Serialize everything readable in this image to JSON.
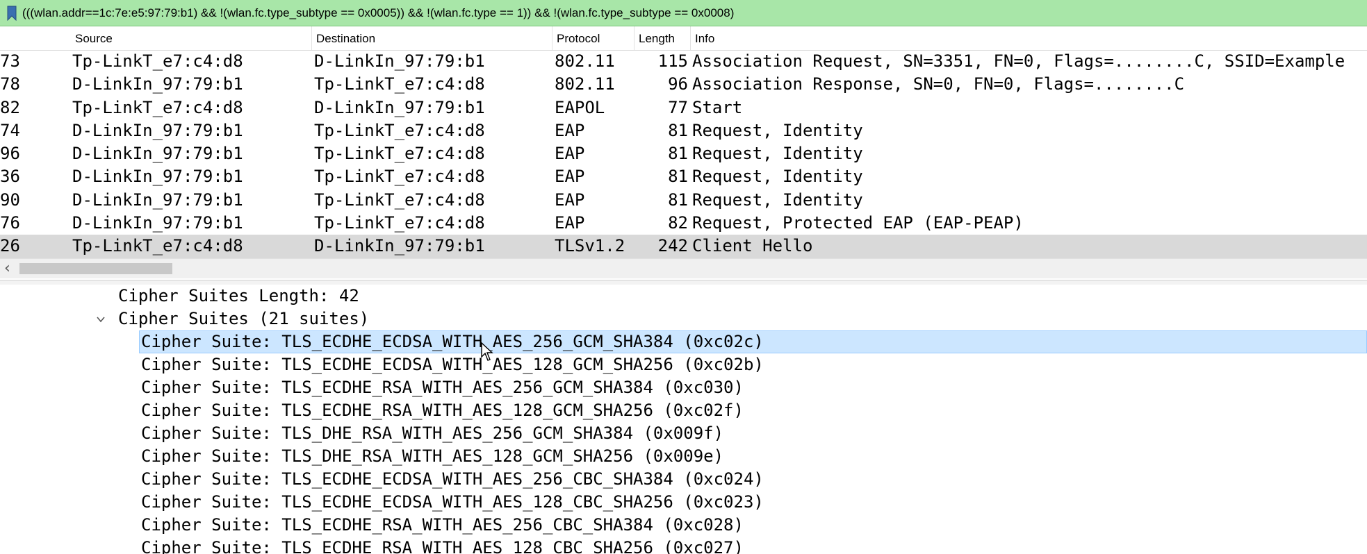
{
  "filter": {
    "expression": "(((wlan.addr==1c:7e:e5:97:79:b1) && !(wlan.fc.type_subtype == 0x0005)) && !(wlan.fc.type == 1)) && !(wlan.fc.type_subtype == 0x0008)"
  },
  "columns": {
    "source": "Source",
    "destination": "Destination",
    "protocol": "Protocol",
    "length": "Length",
    "info": "Info"
  },
  "packets": [
    {
      "no": "73",
      "source": "Tp-LinkT_e7:c4:d8",
      "destination": "D-LinkIn_97:79:b1",
      "protocol": "802.11",
      "length": "115",
      "info": "Association Request, SN=3351, FN=0, Flags=........C, SSID=Example"
    },
    {
      "no": "78",
      "source": "D-LinkIn_97:79:b1",
      "destination": "Tp-LinkT_e7:c4:d8",
      "protocol": "802.11",
      "length": "96",
      "info": "Association Response, SN=0, FN=0, Flags=........C"
    },
    {
      "no": "82",
      "source": "Tp-LinkT_e7:c4:d8",
      "destination": "D-LinkIn_97:79:b1",
      "protocol": "EAPOL",
      "length": "77",
      "info": "Start"
    },
    {
      "no": "74",
      "source": "D-LinkIn_97:79:b1",
      "destination": "Tp-LinkT_e7:c4:d8",
      "protocol": "EAP",
      "length": "81",
      "info": "Request, Identity"
    },
    {
      "no": "96",
      "source": "D-LinkIn_97:79:b1",
      "destination": "Tp-LinkT_e7:c4:d8",
      "protocol": "EAP",
      "length": "81",
      "info": "Request, Identity"
    },
    {
      "no": "36",
      "source": "D-LinkIn_97:79:b1",
      "destination": "Tp-LinkT_e7:c4:d8",
      "protocol": "EAP",
      "length": "81",
      "info": "Request, Identity"
    },
    {
      "no": "90",
      "source": "D-LinkIn_97:79:b1",
      "destination": "Tp-LinkT_e7:c4:d8",
      "protocol": "EAP",
      "length": "81",
      "info": "Request, Identity"
    },
    {
      "no": "76",
      "source": "D-LinkIn_97:79:b1",
      "destination": "Tp-LinkT_e7:c4:d8",
      "protocol": "EAP",
      "length": "82",
      "info": "Request, Protected EAP (EAP-PEAP)"
    },
    {
      "no": "26",
      "source": "Tp-LinkT_e7:c4:d8",
      "destination": "D-LinkIn_97:79:b1",
      "protocol": "TLSv1.2",
      "length": "242",
      "info": "Client Hello"
    }
  ],
  "details": {
    "cipher_suites_length": "Cipher Suites Length: 42",
    "cipher_suites_header": "Cipher Suites (21 suites)",
    "suites": [
      "Cipher Suite: TLS_ECDHE_ECDSA_WITH_AES_256_GCM_SHA384 (0xc02c)",
      "Cipher Suite: TLS_ECDHE_ECDSA_WITH_AES_128_GCM_SHA256 (0xc02b)",
      "Cipher Suite: TLS_ECDHE_RSA_WITH_AES_256_GCM_SHA384 (0xc030)",
      "Cipher Suite: TLS_ECDHE_RSA_WITH_AES_128_GCM_SHA256 (0xc02f)",
      "Cipher Suite: TLS_DHE_RSA_WITH_AES_256_GCM_SHA384 (0x009f)",
      "Cipher Suite: TLS_DHE_RSA_WITH_AES_128_GCM_SHA256 (0x009e)",
      "Cipher Suite: TLS_ECDHE_ECDSA_WITH_AES_256_CBC_SHA384 (0xc024)",
      "Cipher Suite: TLS_ECDHE_ECDSA_WITH_AES_128_CBC_SHA256 (0xc023)",
      "Cipher Suite: TLS_ECDHE_RSA_WITH_AES_256_CBC_SHA384 (0xc028)",
      "Cipher Suite: TLS_ECDHE_RSA_WITH_AES_128_CBC_SHA256 (0xc027)"
    ]
  },
  "colors": {
    "filter_ok": "#a8e6a8",
    "selected_packet": "#d9d9d9",
    "selected_detail": "#cce6ff"
  }
}
